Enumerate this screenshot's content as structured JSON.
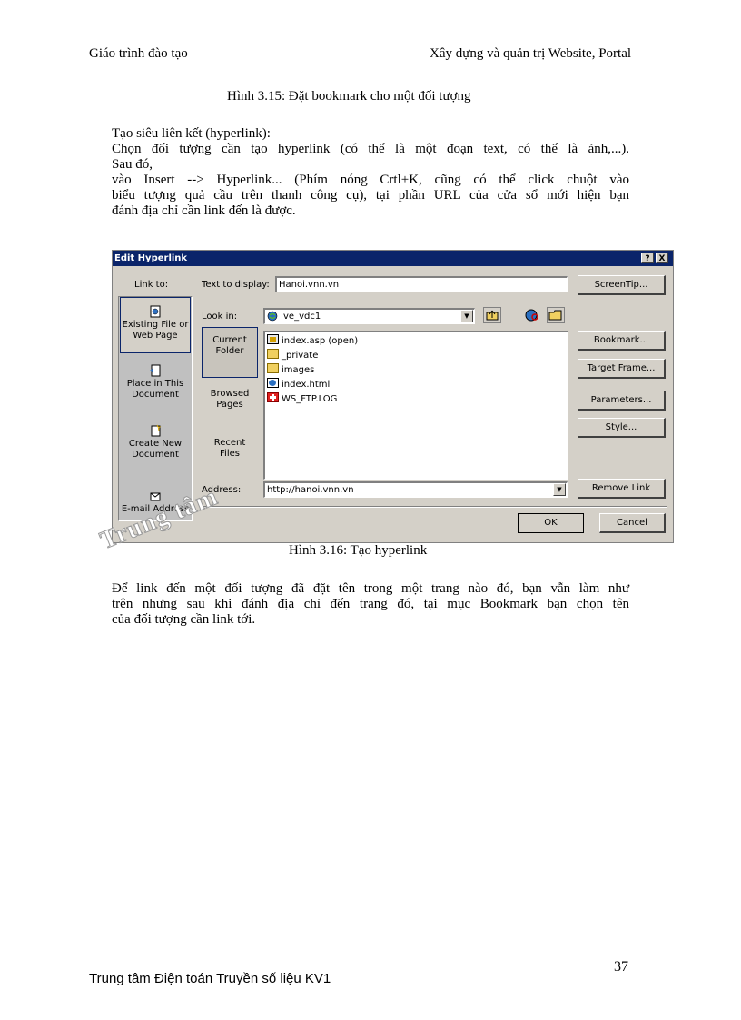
{
  "header": {
    "left": "Giáo trình đào tạo",
    "right": "Xây dựng và quản trị Website, Portal"
  },
  "fig_caption_1": "Hình 3.15: Đặt bookmark cho một đối tượng",
  "paragraph_1": {
    "line1": "Tạo siêu liên kết (hyperlink):",
    "line2": "Chọn đối tượng cần tạo hyperlink (có thể là một đoạn text, có thể là ảnh,...).",
    "line3": "Sau đó,",
    "line4": "vào Insert --> Hyperlink... (Phím nóng Crtl+K, cũng có thể click chuột vào",
    "line5": "biểu tượng quả cầu trên thanh công cụ), tại phần URL của cửa sổ mới hiện bạn",
    "line6": "đánh địa chỉ cần link đến là được."
  },
  "dialog": {
    "title": "Edit Hyperlink",
    "help_btn": "?",
    "close_btn": "X",
    "link_to_label": "Link to:",
    "link_to_items": [
      "Existing File or Web Page",
      "Place in This Document",
      "Create New Document",
      "E-mail Address"
    ],
    "text_to_display_label": "Text to display:",
    "text_to_display_value": "Hanoi.vnn.vn",
    "screentip_btn": "ScreenTip...",
    "look_in_label": "Look in:",
    "look_in_value": "ve_vdc1",
    "nav_items": [
      "Current Folder",
      "Browsed Pages",
      "Recent Files"
    ],
    "files": [
      {
        "name": "index.asp (open)",
        "icon": "asp-file-icon"
      },
      {
        "name": "_private",
        "icon": "folder-icon"
      },
      {
        "name": "images",
        "icon": "folder-icon"
      },
      {
        "name": "index.html",
        "icon": "html-file-icon"
      },
      {
        "name": "WS_FTP.LOG",
        "icon": "log-file-icon"
      }
    ],
    "bookmark_btn": "Bookmark...",
    "target_frame_btn": "Target Frame...",
    "parameters_btn": "Parameters...",
    "style_btn": "Style...",
    "address_label": "Address:",
    "address_value": "http://hanoi.vnn.vn",
    "remove_link_btn": "Remove Link",
    "ok_btn": "OK",
    "cancel_btn": "Cancel"
  },
  "fig_caption_2": "Hình 3.16: Tạo hyperlink",
  "watermark": "Trung tâm",
  "paragraph_2": {
    "line1": "Để link đến một đối tượng đã đặt tên trong một trang nào đó, bạn vẫn làm như",
    "line2": "trên nhưng sau khi đánh địa chỉ đến trang đó, tại mục Bookmark  bạn chọn tên",
    "line3": "của đối tượng cần link tới."
  },
  "footer": {
    "left": "Trung tâm Điện toán Truyền số liệu KV1",
    "page_number": "37"
  }
}
